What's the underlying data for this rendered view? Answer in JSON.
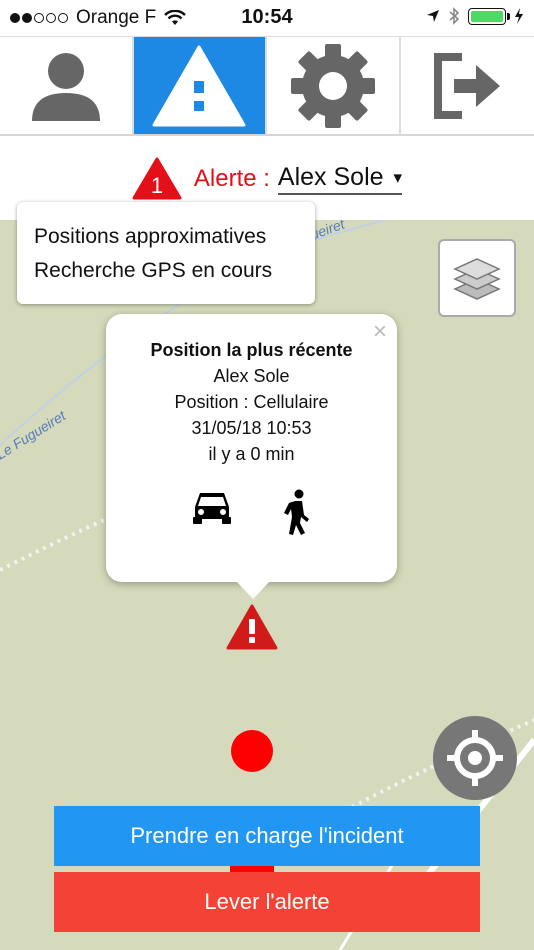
{
  "status_bar": {
    "carrier": "Orange F",
    "time": "10:54"
  },
  "tabs": [
    {
      "name": "profile",
      "icon": "person-icon"
    },
    {
      "name": "alerts",
      "icon": "warning-icon",
      "active": true
    },
    {
      "name": "settings",
      "icon": "gear-icon"
    },
    {
      "name": "logout",
      "icon": "logout-icon"
    }
  ],
  "alert_header": {
    "badge_count": "1",
    "label": "Alerte :",
    "selected_person": "Alex Sole",
    "caret": "▾"
  },
  "info_card": {
    "line1": "Positions approximatives",
    "line2": "Recherche GPS en cours"
  },
  "map": {
    "street_labels": [
      "Le Fugueiret",
      "Fugueiret"
    ]
  },
  "popup": {
    "close": "×",
    "title": "Position la plus récente",
    "name": "Alex Sole",
    "position": "Position : Cellulaire",
    "datetime": "31/05/18 10:53",
    "elapsed": "il y a 0 min",
    "icons": [
      "car-icon",
      "walking-person-icon"
    ]
  },
  "actions": {
    "take_charge": "Prendre en charge l'incident",
    "lift_alert": "Lever l'alerte"
  },
  "colors": {
    "primary_blue": "#2196f3",
    "tab_active_blue": "#1e88e5",
    "alert_red": "#f44336",
    "marker_red": "#ff0000",
    "map_bg": "#d4dabb"
  }
}
